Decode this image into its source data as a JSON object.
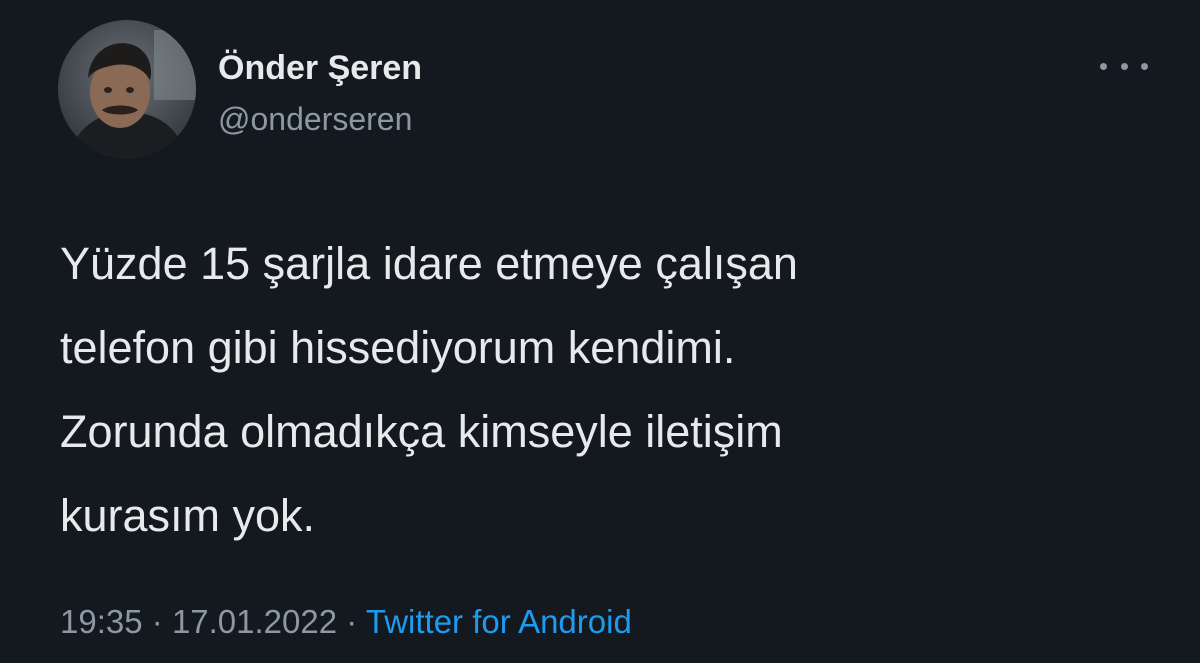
{
  "author": {
    "display_name": "Önder Şeren",
    "handle": "@onderseren"
  },
  "tweet": {
    "lines": [
      "Yüzde 15 şarjla idare etmeye çalışan",
      "telefon gibi hissediyorum kendimi.",
      "Zorunda olmadıkça kimseyle iletişim",
      "kurasım yok."
    ]
  },
  "meta": {
    "time": "19:35",
    "separator": "·",
    "date": "17.01.2022",
    "source": "Twitter for Android"
  },
  "icons": {
    "more": "more-horizontal-icon"
  },
  "colors": {
    "background": "#14181f",
    "text_primary": "#e7e9ea",
    "text_secondary": "#8b98a5",
    "link": "#1d9bf0"
  }
}
